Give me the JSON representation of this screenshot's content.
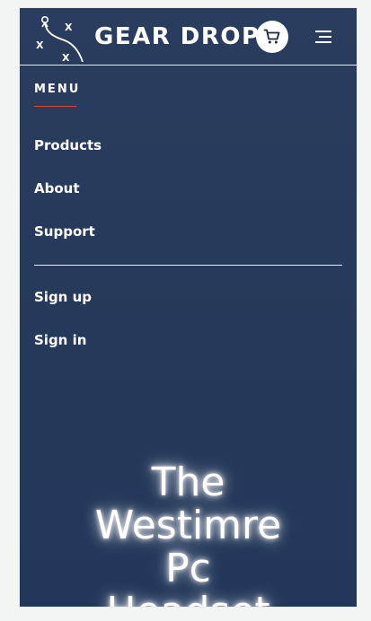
{
  "brand": {
    "name": "GEAR DROP",
    "logo_icon": "play-diagram-logo",
    "logo_marks": [
      "X",
      "X",
      "X"
    ]
  },
  "header": {
    "cart_icon": "cart-icon",
    "menu_icon": "hamburger-menu-icon"
  },
  "menu": {
    "title": "MENU",
    "primary_items": [
      {
        "label": "Products"
      },
      {
        "label": "About"
      },
      {
        "label": "Support"
      }
    ],
    "account_items": [
      {
        "label": "Sign up"
      },
      {
        "label": "Sign in"
      }
    ]
  },
  "hero": {
    "title_lines": [
      "The",
      "Westimre",
      "Pc",
      "Headset"
    ]
  },
  "colors": {
    "panel_top": "#2a3d5e",
    "panel_bottom": "#22375a",
    "accent_underline": "#d4473f",
    "page_background": "#f3f4f4"
  }
}
